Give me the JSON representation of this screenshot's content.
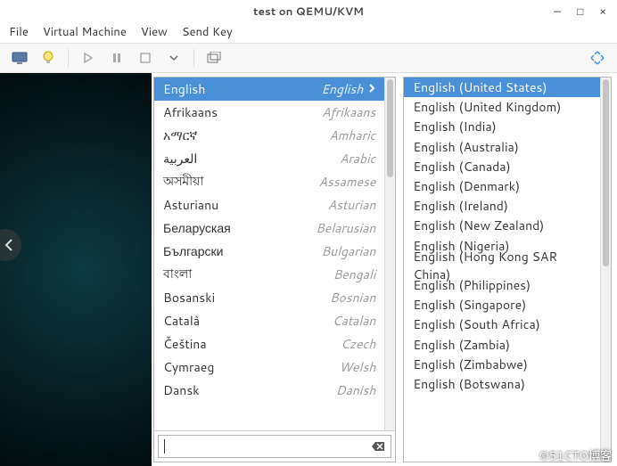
{
  "window": {
    "title": "test on QEMU/KVM",
    "controls": {
      "min": "—",
      "max": "□",
      "close": "×"
    }
  },
  "menu": {
    "file": "File",
    "vm": "Virtual Machine",
    "view": "View",
    "sendkey": "Send Key"
  },
  "languages": [
    {
      "native": "English",
      "english": "English",
      "selected": true
    },
    {
      "native": "Afrikaans",
      "english": "Afrikaans"
    },
    {
      "native": "አማርኛ",
      "english": "Amharic"
    },
    {
      "native": "العربية",
      "english": "Arabic"
    },
    {
      "native": "অসমীয়া",
      "english": "Assamese"
    },
    {
      "native": "Asturianu",
      "english": "Asturian"
    },
    {
      "native": "Беларуская",
      "english": "Belarusian"
    },
    {
      "native": "Български",
      "english": "Bulgarian"
    },
    {
      "native": "বাংলা",
      "english": "Bengali"
    },
    {
      "native": "Bosanski",
      "english": "Bosnian"
    },
    {
      "native": "Català",
      "english": "Catalan"
    },
    {
      "native": "Čeština",
      "english": "Czech"
    },
    {
      "native": "Cymraeg",
      "english": "Welsh"
    },
    {
      "native": "Dansk",
      "english": "Danish"
    }
  ],
  "variants": [
    {
      "label": "English (United States)",
      "selected": true
    },
    {
      "label": "English (United Kingdom)"
    },
    {
      "label": "English (India)"
    },
    {
      "label": "English (Australia)"
    },
    {
      "label": "English (Canada)"
    },
    {
      "label": "English (Denmark)"
    },
    {
      "label": "English (Ireland)"
    },
    {
      "label": "English (New Zealand)"
    },
    {
      "label": "English (Nigeria)"
    },
    {
      "label": "English (Hong Kong SAR China)"
    },
    {
      "label": "English (Philippines)"
    },
    {
      "label": "English (Singapore)"
    },
    {
      "label": "English (South Africa)"
    },
    {
      "label": "English (Zambia)"
    },
    {
      "label": "English (Zimbabwe)"
    },
    {
      "label": "English (Botswana)"
    }
  ],
  "search": {
    "value": ""
  },
  "watermark": "©51CTO博客"
}
